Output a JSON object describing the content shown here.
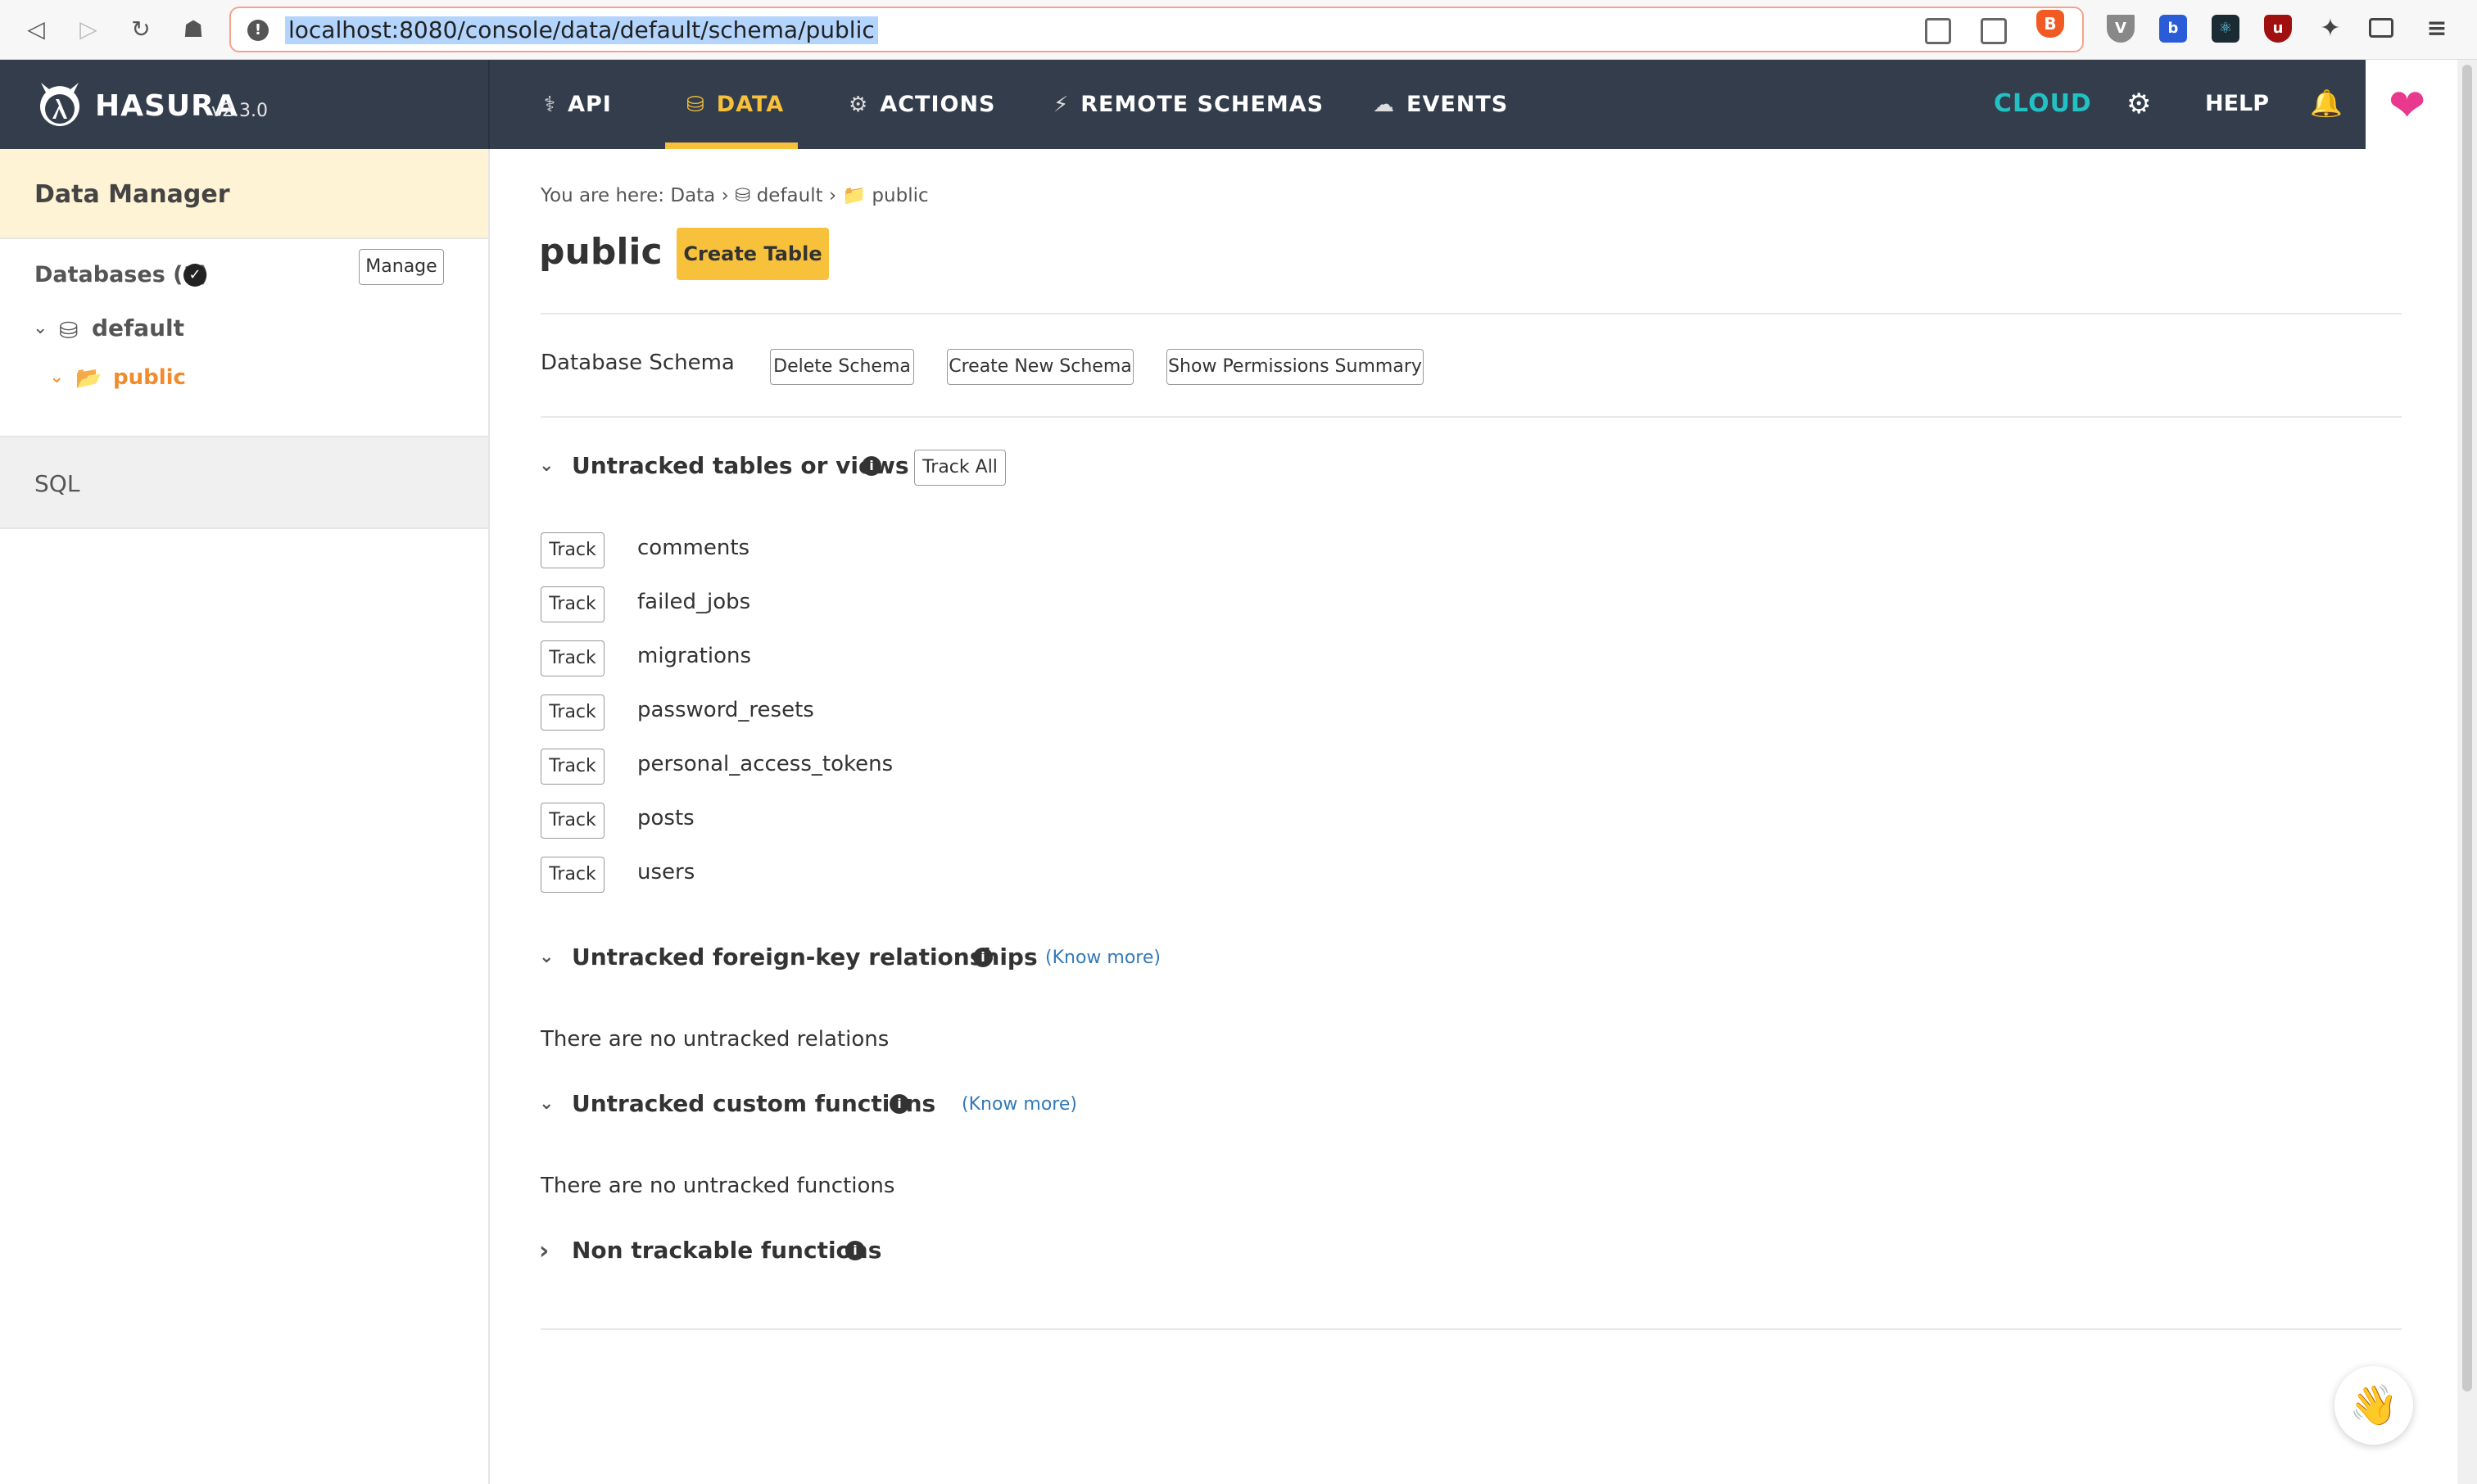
{
  "browser": {
    "url": "localhost:8080/console/data/default/schema/public"
  },
  "header": {
    "brand": "HASURA",
    "version": "v2.3.0",
    "nav": [
      {
        "label": "API",
        "icon": "flask-icon"
      },
      {
        "label": "DATA",
        "icon": "database-icon",
        "active": true
      },
      {
        "label": "ACTIONS",
        "icon": "cogs-icon"
      },
      {
        "label": "REMOTE SCHEMAS",
        "icon": "plug-icon"
      },
      {
        "label": "EVENTS",
        "icon": "cloud-icon"
      }
    ],
    "cloud": "CLOUD",
    "help": "HELP"
  },
  "sidebar": {
    "title": "Data Manager",
    "databases_label": "Databases (1)",
    "manage": "Manage",
    "database": "default",
    "schema": "public",
    "sql": "SQL"
  },
  "main": {
    "breadcrumb": {
      "prefix": "You are here: ",
      "data": "Data",
      "db": "default",
      "schema": "public"
    },
    "title": "public",
    "create_table": "Create Table",
    "schema_label": "Database Schema",
    "delete_schema": "Delete Schema",
    "create_schema": "Create New Schema",
    "permissions_summary": "Show Permissions Summary",
    "untracked_tables": {
      "title": "Untracked tables or views",
      "track_all": "Track All",
      "track_label": "Track",
      "tables": [
        "comments",
        "failed_jobs",
        "migrations",
        "password_resets",
        "personal_access_tokens",
        "posts",
        "users"
      ]
    },
    "untracked_fk": {
      "title": "Untracked foreign-key relationships",
      "know_more": "(Know more)",
      "empty": "There are no untracked relations"
    },
    "untracked_functions": {
      "title": "Untracked custom functions",
      "know_more": "(Know more)",
      "empty": "There are no untracked functions"
    },
    "non_trackable": {
      "title": "Non trackable functions"
    }
  },
  "colors": {
    "header_bg": "#333d4c",
    "accent": "#f7c13b",
    "cloud": "#22c1c3",
    "active_tree": "#f28b2b",
    "sidebar_highlight": "#fff3d5"
  }
}
